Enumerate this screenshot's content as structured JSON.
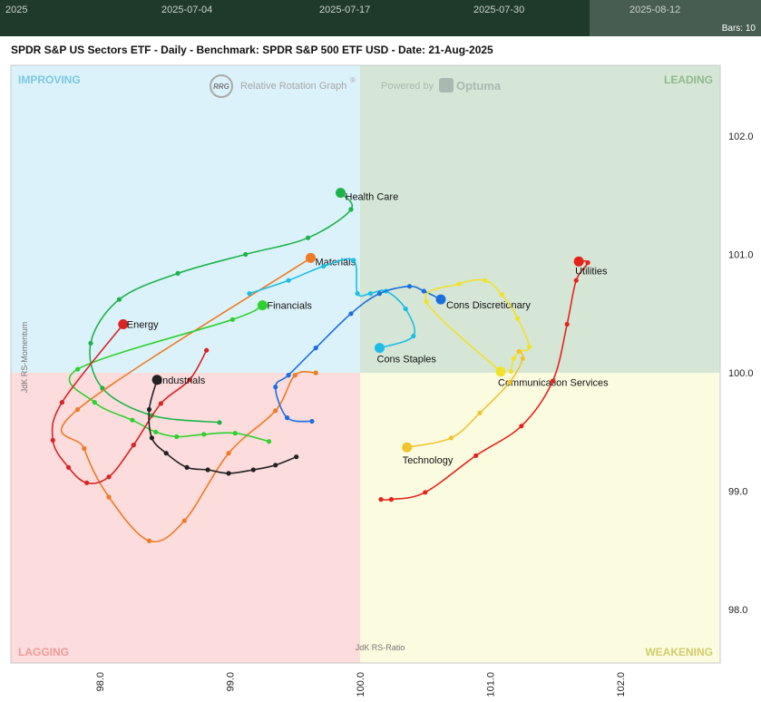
{
  "timeline": {
    "labels": [
      "2025",
      "2025-07-04",
      "2025-07-17",
      "2025-07-30",
      "2025-08-12"
    ],
    "bars_text": "Bars: 10"
  },
  "chart_title": "SPDR S&P US Sectors ETF - Daily - Benchmark: SPDR S&P 500 ETF USD - Date: 21-Aug-2025",
  "watermark": {
    "rrg_badge": "RRG",
    "rrg_text": "Relative Rotation Graph",
    "rrg_reg": "®",
    "powered_by": "Powered by",
    "optuma": "Optuma"
  },
  "quadrants": {
    "improving": "IMPROVING",
    "leading": "LEADING",
    "lagging": "LAGGING",
    "weakening": "WEAKENING"
  },
  "colors": {
    "improving": "#dcf2fa",
    "leading": "#d5e6d6",
    "lagging": "#fcdcdc",
    "weakening": "#fbfbe0",
    "improving_text": "#7cc7e1",
    "leading_text": "#8fb98f",
    "lagging_text": "#ee9b9b",
    "weakening_text": "#d0cd6b"
  },
  "chart_data": {
    "type": "scatter",
    "title": "SPDR S&P US Sectors ETF - Daily - Benchmark: SPDR S&P 500 ETF USD - Date: 21-Aug-2025",
    "xlabel": "JdK RS-Ratio",
    "ylabel": "JdK RS-Momentum",
    "xlim": [
      97.6,
      102.8
    ],
    "ylim": [
      97.6,
      102.6
    ],
    "x_ticks": [
      "98.0",
      "99.0",
      "100.0",
      "101.0",
      "102.0"
    ],
    "y_ticks": [
      "102.0",
      "101.0",
      "100.0",
      "99.0",
      "98.0"
    ],
    "center": [
      100.0,
      100.0
    ],
    "series": [
      {
        "name": "Health Care",
        "color": "#1db34a",
        "x": [
          98.92,
          98.4,
          98.02,
          97.93,
          98.15,
          98.6,
          99.12,
          99.6,
          99.93,
          99.85
        ],
        "y": [
          99.58,
          99.64,
          99.87,
          100.25,
          100.62,
          100.84,
          101.0,
          101.14,
          101.38,
          101.52
        ]
      },
      {
        "name": "Materials",
        "color": "#f07a22",
        "x": [
          99.66,
          99.5,
          99.35,
          98.99,
          98.65,
          98.38,
          98.07,
          97.88,
          97.83,
          99.62
        ],
        "y": [
          100.0,
          99.98,
          99.68,
          99.32,
          98.75,
          98.58,
          98.95,
          99.36,
          99.69,
          100.97
        ]
      },
      {
        "name": "Financials",
        "color": "#2ed12e",
        "x": [
          99.3,
          99.04,
          98.8,
          98.59,
          98.43,
          98.25,
          97.96,
          97.83,
          99.02,
          99.25
        ],
        "y": [
          99.42,
          99.49,
          99.48,
          99.46,
          99.5,
          99.6,
          99.75,
          100.03,
          100.45,
          100.57
        ]
      },
      {
        "name": "Energy",
        "color": "#d92424",
        "x": [
          98.82,
          98.69,
          98.47,
          98.26,
          98.07,
          97.9,
          97.76,
          97.64,
          97.71,
          98.18
        ],
        "y": [
          100.19,
          99.94,
          99.74,
          99.39,
          99.12,
          99.07,
          99.2,
          99.43,
          99.75,
          100.41
        ]
      },
      {
        "name": "Industrials",
        "color": "#222222",
        "x": [
          99.51,
          99.35,
          99.18,
          98.99,
          98.83,
          98.67,
          98.51,
          98.4,
          98.38,
          98.44
        ],
        "y": [
          99.29,
          99.22,
          99.18,
          99.15,
          99.18,
          99.2,
          99.32,
          99.45,
          99.69,
          99.94
        ]
      },
      {
        "name": "Cons Staples",
        "color": "#1cbde6",
        "x": [
          99.15,
          99.45,
          99.72,
          99.95,
          99.98,
          100.08,
          100.2,
          100.35,
          100.41,
          100.15
        ],
        "y": [
          100.67,
          100.78,
          100.9,
          100.95,
          100.67,
          100.67,
          100.69,
          100.54,
          100.31,
          100.21
        ]
      },
      {
        "name": "Cons Discretionary",
        "color": "#1a6fe0",
        "x": [
          99.63,
          99.44,
          99.35,
          99.45,
          99.66,
          99.93,
          100.15,
          100.38,
          100.49,
          100.62
        ],
        "y": [
          99.59,
          99.62,
          99.88,
          99.98,
          100.21,
          100.5,
          100.67,
          100.73,
          100.69,
          100.62
        ]
      },
      {
        "name": "Communication Services",
        "color": "#f2e12a",
        "x": [
          101.16,
          101.18,
          101.23,
          101.3,
          101.21,
          101.09,
          100.96,
          100.76,
          100.51,
          101.08
        ],
        "y": [
          100.01,
          100.12,
          100.18,
          100.22,
          100.46,
          100.66,
          100.78,
          100.75,
          100.6,
          100.01
        ]
      },
      {
        "name": "Technology",
        "color": "#f0c42d",
        "x": [
          101.22,
          101.25,
          101.15,
          100.92,
          100.7,
          100.36
        ],
        "y": [
          100.18,
          100.12,
          99.92,
          99.66,
          99.45,
          99.37
        ]
      },
      {
        "name": "Utilities",
        "color": "#e5231b",
        "x": [
          100.16,
          100.24,
          100.5,
          100.89,
          101.24,
          101.48,
          101.59,
          101.66,
          101.75,
          101.68
        ],
        "y": [
          98.93,
          98.93,
          98.99,
          99.3,
          99.55,
          99.93,
          100.41,
          100.78,
          100.93,
          100.94
        ]
      }
    ]
  }
}
